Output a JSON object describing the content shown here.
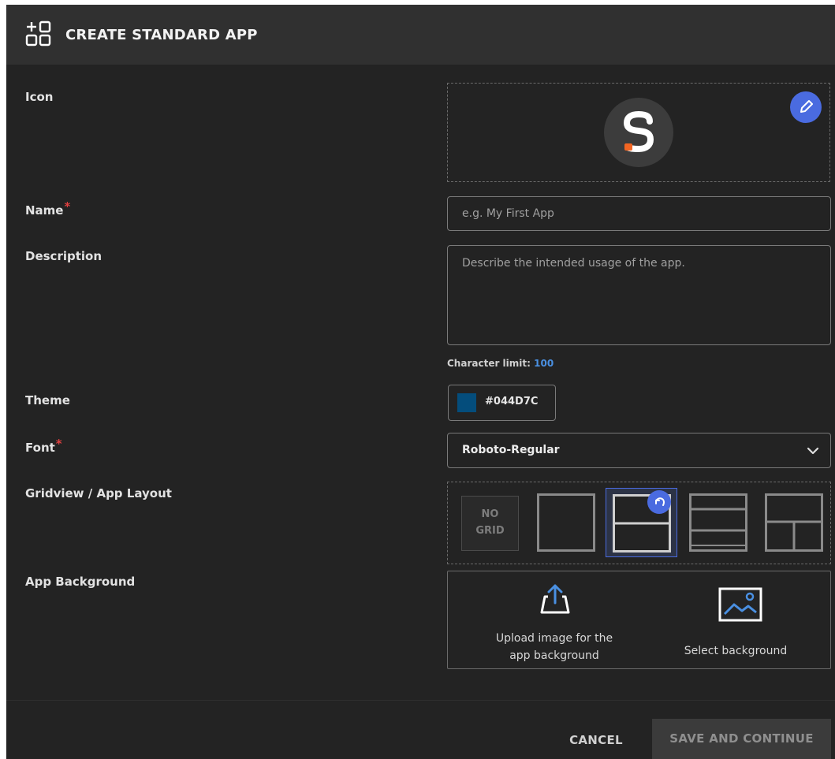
{
  "dialog": {
    "title": "CREATE STANDARD APP",
    "header_icon": "app-grid-add-icon"
  },
  "fields": {
    "icon": {
      "label": "Icon",
      "logo_icon": "app-logo-s-icon",
      "edit_icon": "pencil-icon"
    },
    "name": {
      "label": "Name",
      "required_mark": "*",
      "value": "",
      "placeholder": "e.g. My First App"
    },
    "description": {
      "label": "Description",
      "value": "",
      "placeholder": "Describe the intended usage of the app.",
      "char_limit_label": "Character limit:",
      "char_limit_value": "100"
    },
    "theme": {
      "label": "Theme",
      "color": "#044D7C",
      "color_text": "#044D7C"
    },
    "font": {
      "label": "Font",
      "required_mark": "*",
      "selected": "Roboto-Regular"
    },
    "layout": {
      "label": "Gridview / App Layout",
      "no_grid_line1": "NO",
      "no_grid_line2": "GRID",
      "options": [
        "no-grid",
        "single",
        "two-rows",
        "three-rows",
        "top-and-two-bottom"
      ],
      "selected": "two-rows",
      "undo_icon": "undo-icon"
    },
    "background": {
      "label": "App Background",
      "upload_label": "Upload image for the\napp background",
      "upload_icon": "upload-icon",
      "select_label": "Select background",
      "select_icon": "image-icon"
    }
  },
  "footer": {
    "cancel_label": "CANCEL",
    "save_label": "SAVE AND CONTINUE"
  },
  "colors": {
    "dialog_bg": "#232323",
    "header_bg": "#303030",
    "accent": "#4a6be0",
    "link": "#4a90e2",
    "required": "#e04040",
    "logo_accent": "#f26522"
  }
}
